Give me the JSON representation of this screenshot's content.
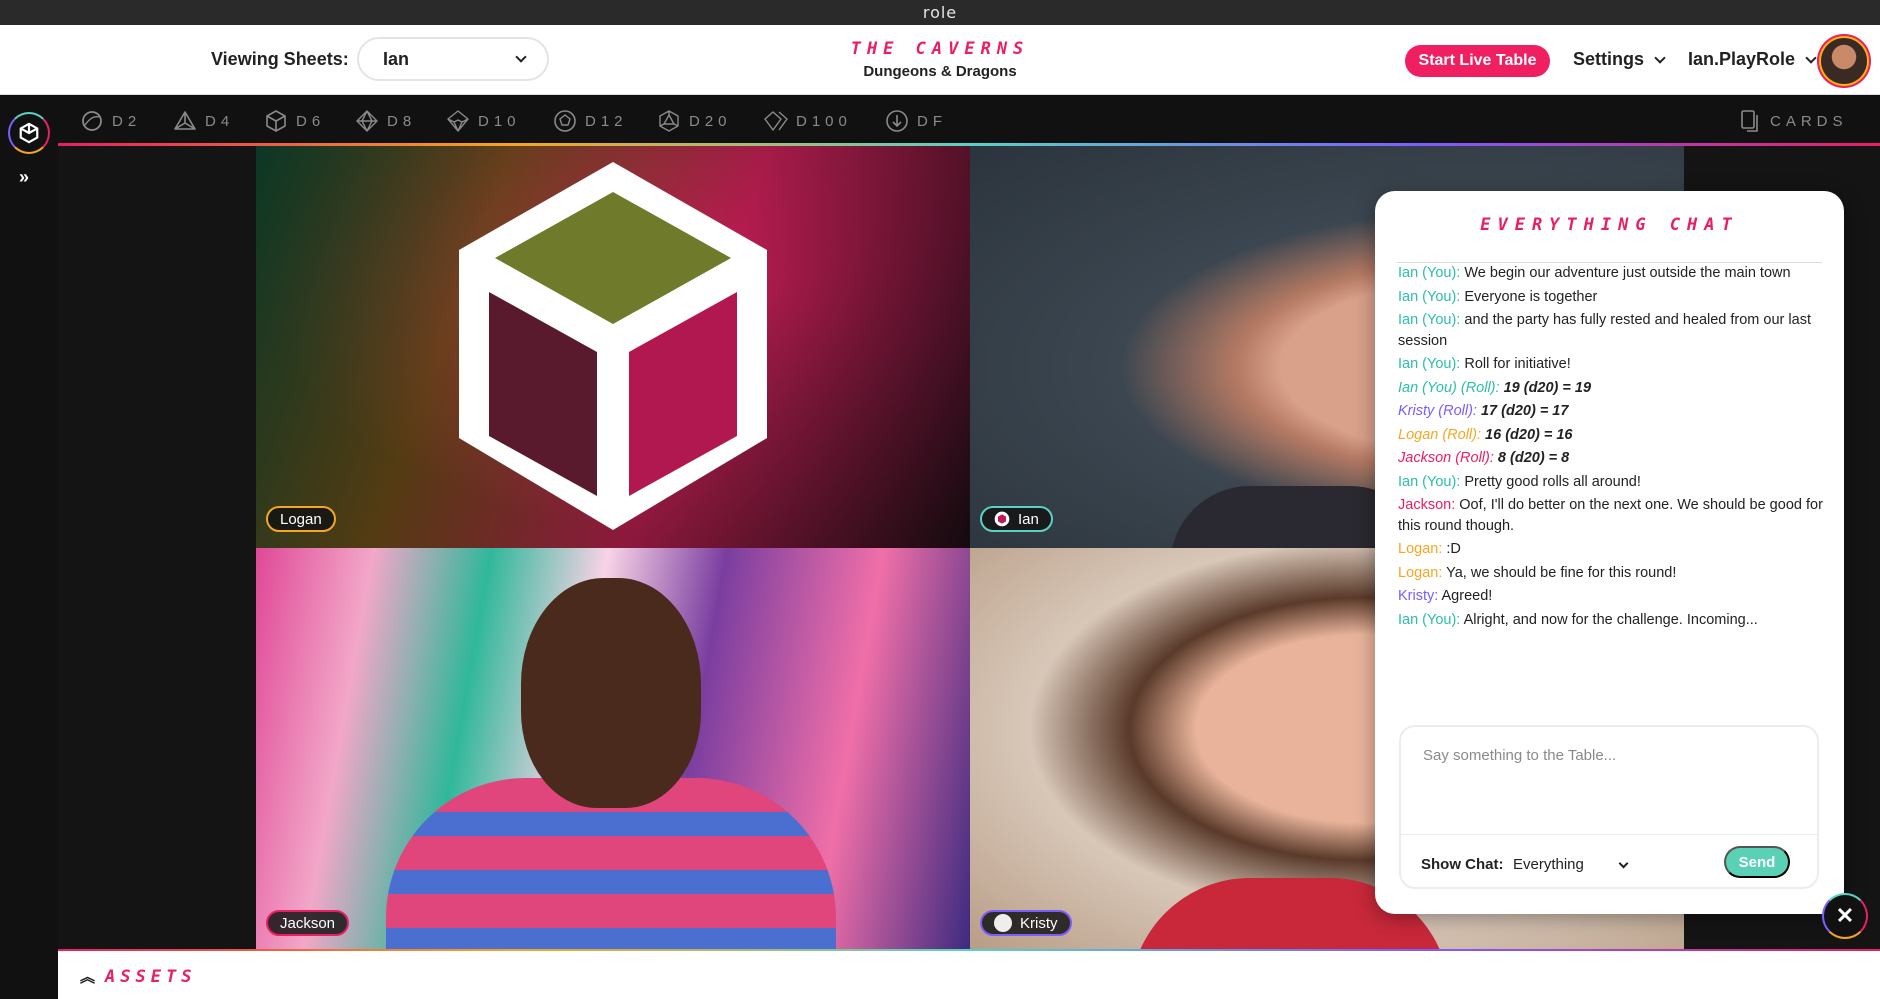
{
  "app": {
    "title": "role"
  },
  "header": {
    "viewing_label": "Viewing Sheets:",
    "sheet_value": "Ian",
    "brand_title": "THE CAVERNS",
    "brand_subtitle": "Dungeons & Dragons",
    "live_button": "Start Live Table",
    "settings_label": "Settings",
    "username": "Ian.PlayRole"
  },
  "dice": [
    {
      "label": "D2",
      "icon": "d2-icon"
    },
    {
      "label": "D4",
      "icon": "d4-icon"
    },
    {
      "label": "D6",
      "icon": "d6-icon"
    },
    {
      "label": "D8",
      "icon": "d8-icon"
    },
    {
      "label": "D10",
      "icon": "d10-icon"
    },
    {
      "label": "D12",
      "icon": "d12-icon"
    },
    {
      "label": "D20",
      "icon": "d20-icon"
    },
    {
      "label": "D100",
      "icon": "d100-icon"
    },
    {
      "label": "DF",
      "icon": "df-icon"
    }
  ],
  "cards_label": "CARDS",
  "tiles": [
    {
      "name": "Logan",
      "color": "#f5a623"
    },
    {
      "name": "Ian",
      "color": "#5ad1c4"
    },
    {
      "name": "Jackson",
      "color": "#e91e63"
    },
    {
      "name": "Kristy",
      "color": "#7c5cff"
    }
  ],
  "chat": {
    "title": "EVERYTHING CHAT",
    "messages": [
      {
        "who": "Ian (You):",
        "text": "We begin our adventure just outside the main town",
        "color": "#2bbfa8",
        "roll": false
      },
      {
        "who": "Ian (You):",
        "text": "Everyone is together",
        "color": "#2bbfa8",
        "roll": false
      },
      {
        "who": "Ian (You):",
        "text": "and the party has fully rested and healed from our last session",
        "color": "#2bbfa8",
        "roll": false
      },
      {
        "who": "Ian (You):",
        "text": "Roll for initiative!",
        "color": "#2bbfa8",
        "roll": false
      },
      {
        "who": "Ian (You) (Roll):",
        "text": "19 (d20) = 19",
        "color": "#2bbfa8",
        "roll": true
      },
      {
        "who": "Kristy (Roll):",
        "text": "17 (d20) = 17",
        "color": "#7c5cff",
        "roll": true
      },
      {
        "who": "Logan (Roll):",
        "text": "16 (d20) = 16",
        "color": "#f5a623",
        "roll": true
      },
      {
        "who": "Jackson (Roll):",
        "text": "8 (d20) = 8",
        "color": "#e91e63",
        "roll": true
      },
      {
        "who": "Ian (You):",
        "text": "Pretty good rolls all around!",
        "color": "#2bbfa8",
        "roll": false
      },
      {
        "who": "Jackson:",
        "text": "Oof, I'll do better on the next one. We should be good for this round though.",
        "color": "#e91e63",
        "roll": false
      },
      {
        "who": "Logan:",
        "text": ":D",
        "color": "#f5a623",
        "roll": false
      },
      {
        "who": "Logan:",
        "text": "Ya, we should be fine for this round!",
        "color": "#f5a623",
        "roll": false
      },
      {
        "who": "Kristy:",
        "text": "Agreed!",
        "color": "#7c5cff",
        "roll": false
      },
      {
        "who": "Ian (You):",
        "text": "Alright, and now for the challenge. Incoming...",
        "color": "#2bbfa8",
        "roll": false
      }
    ],
    "input_placeholder": "Say something to the Table...",
    "show_chat_label": "Show Chat:",
    "show_chat_value": "Everything",
    "send_label": "Send"
  },
  "assets_label": "ASSETS",
  "colors": {
    "accent": "#e91e63",
    "teal": "#5ad1c4",
    "orange": "#f5a623",
    "purple": "#7c5cff"
  }
}
